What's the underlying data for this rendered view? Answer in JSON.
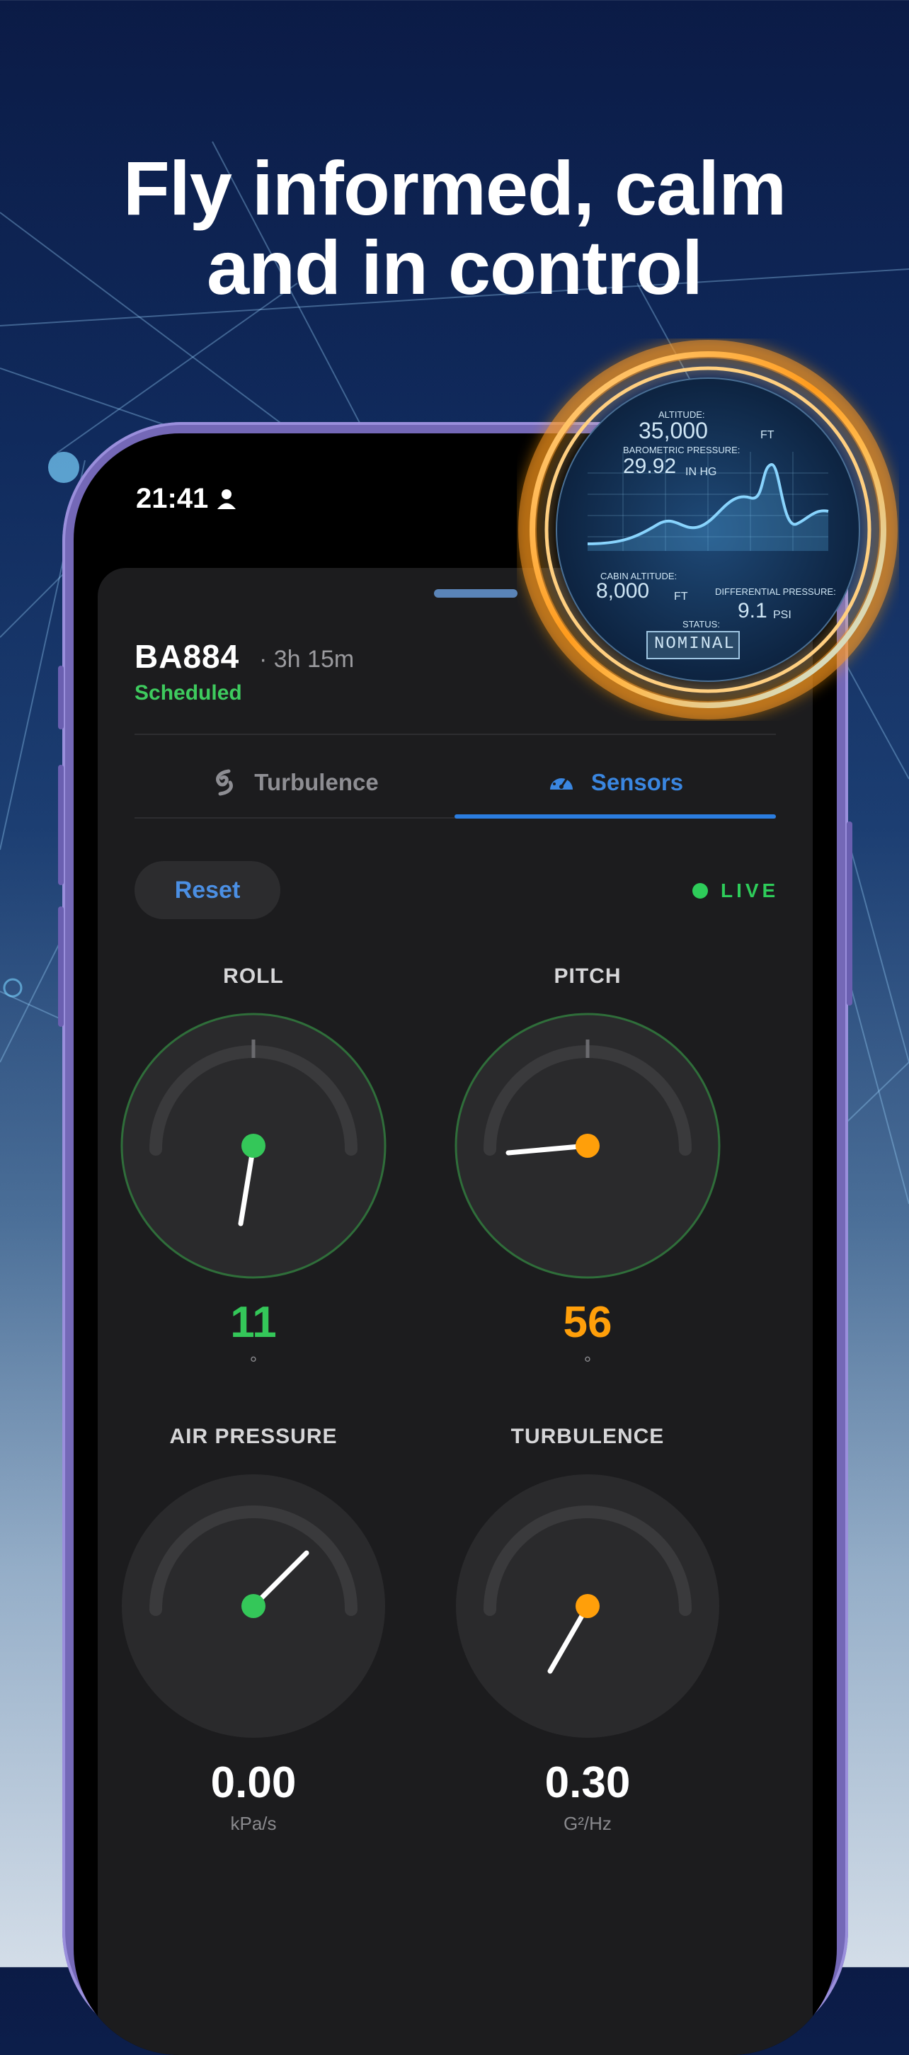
{
  "headline": {
    "line1": "Fly informed, calm",
    "line2": "and in control"
  },
  "status_bar": {
    "time": "21:41"
  },
  "flight": {
    "id": "BA884",
    "duration": "· 3h 15m",
    "status": "Scheduled"
  },
  "tabs": [
    {
      "label": "Turbulence",
      "active": false,
      "icon": "hurricane-icon"
    },
    {
      "label": "Sensors",
      "active": true,
      "icon": "gauge-icon"
    }
  ],
  "controls": {
    "reset_label": "Reset",
    "live_label": "LIVE"
  },
  "gauges": [
    {
      "title": "ROLL",
      "value": "11",
      "unit": "°",
      "color": "#34c759"
    },
    {
      "title": "PITCH",
      "value": "56",
      "unit": "°",
      "color": "#ff9f0a"
    },
    {
      "title": "AIR PRESSURE",
      "value": "0.00",
      "unit": "kPa/s",
      "color": "#ffffff"
    },
    {
      "title": "TURBULENCE",
      "value": "0.30",
      "unit": "G²/Hz",
      "color": "#ffffff"
    }
  ],
  "badge": {
    "altitude_label": "ALTITUDE:",
    "altitude_value": "35,000",
    "altitude_unit": "FT",
    "pressure_label": "BAROMETRIC PRESSURE:",
    "pressure_value": "29.92",
    "pressure_unit": "IN HG",
    "cabin_label": "CABIN ALTITUDE:",
    "cabin_value": "8,000",
    "cabin_unit": "FT",
    "diff_label": "DIFFERENTIAL PRESSURE:",
    "diff_value": "9.1",
    "diff_unit": "PSI",
    "status_label": "STATUS:",
    "status_value": "NOMINAL"
  },
  "colors": {
    "accent_blue": "#2b7de0",
    "live_green": "#2ecc5a",
    "scheduled_green": "#3ecb5e",
    "orange": "#ff9f0a"
  }
}
